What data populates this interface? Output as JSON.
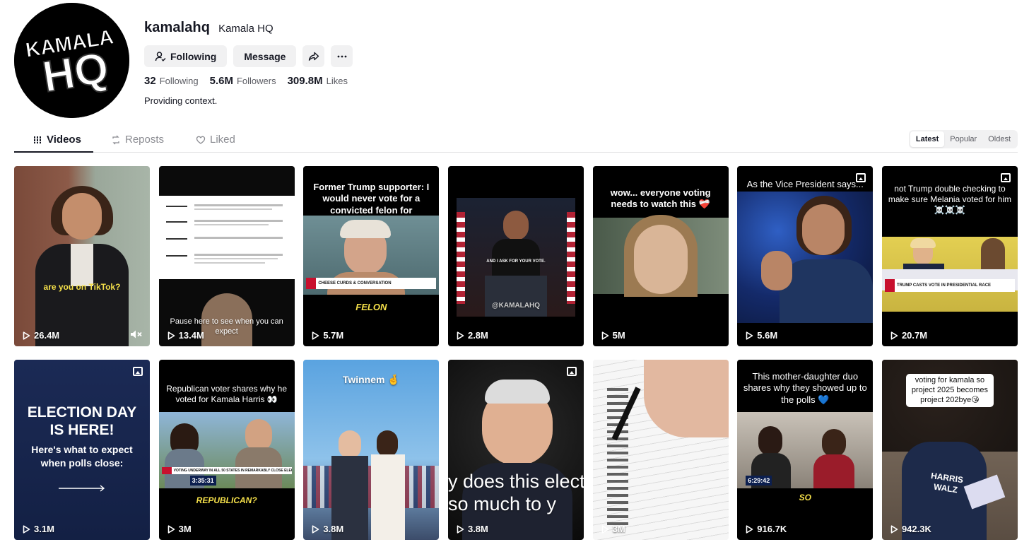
{
  "profile": {
    "avatar_text_top": "KAMALA",
    "avatar_text_bottom": "HQ",
    "username": "kamalahq",
    "nickname": "Kamala HQ",
    "following_label": "Following",
    "message_label": "Message",
    "bio": "Providing context.",
    "stats": [
      {
        "num": "32",
        "label": "Following"
      },
      {
        "num": "5.6M",
        "label": "Followers"
      },
      {
        "num": "309.8M",
        "label": "Likes"
      }
    ]
  },
  "tabs": [
    {
      "label": "Videos",
      "active": true
    },
    {
      "label": "Reposts",
      "active": false
    },
    {
      "label": "Liked",
      "active": false
    }
  ],
  "sort": [
    {
      "label": "Latest",
      "active": true
    },
    {
      "label": "Popular",
      "active": false
    },
    {
      "label": "Oldest",
      "active": false
    }
  ],
  "videos": [
    {
      "views": "26.4M",
      "top_text": "",
      "mid_text": "are you on TikTok?",
      "mute": true,
      "gallery": false
    },
    {
      "views": "13.4M",
      "top_text": "",
      "mid_text": "Pause here to see when you can expect",
      "mute": false,
      "gallery": false
    },
    {
      "views": "5.7M",
      "top_text": "Former Trump supporter: I would never vote for a convicted felon for president 💯",
      "mid_text": "FELON",
      "chyron": "CHEESE CURDS & CONVERSATION",
      "mute": false,
      "gallery": false
    },
    {
      "views": "2.8M",
      "top_text": "",
      "mid_text": "AND I ASK FOR YOUR VOTE.",
      "watermark": "@KAMALAHQ",
      "mute": false,
      "gallery": false
    },
    {
      "views": "5M",
      "top_text": "wow... everyone voting needs to watch this ❤️‍🩹",
      "mid_text": "",
      "mute": false,
      "gallery": false
    },
    {
      "views": "5.6M",
      "top_text": "As the Vice President says...",
      "mid_text": "",
      "mute": false,
      "gallery": true
    },
    {
      "views": "20.7M",
      "top_text": "not Trump double checking to make sure Melania voted for him ☠️☠️☠️",
      "mid_text": "",
      "chyron": "TRUMP CASTS VOTE IN PRESIDENTIAL RACE",
      "mute": false,
      "gallery": true
    },
    {
      "views": "3.1M",
      "top_text": "ELECTION DAY IS HERE!",
      "mid_text": "Here's what to expect when polls close:",
      "mute": false,
      "gallery": true
    },
    {
      "views": "3M",
      "top_text": "Republican voter shares why he voted for Kamala Harris 👀",
      "mid_text": "REPUBLICAN?",
      "chyron": "VOTING UNDERWAY IN ALL 50 STATES IN REMARKABLY CLOSE ELECTION",
      "clock": "3:35:31",
      "mute": false,
      "gallery": false
    },
    {
      "views": "3.8M",
      "top_text": "Twinnem 🤞",
      "mid_text": "",
      "mute": false,
      "gallery": false
    },
    {
      "views": "3.8M",
      "top_text": "",
      "mid_text": "y does this elect ter so much to y",
      "mute": false,
      "gallery": true
    },
    {
      "views": "3M",
      "top_text": "",
      "mid_text": "",
      "mute": false,
      "gallery": false
    },
    {
      "views": "916.7K",
      "top_text": "This mother-daughter duo shares why they showed up to the polls 💙",
      "mid_text": "SO",
      "clock": "6:29:42",
      "mute": false,
      "gallery": false
    },
    {
      "views": "942.3K",
      "top_text": "voting for kamala so project 2025 becomes project 202bye😘",
      "mid_text": "",
      "shirt": "HARRIS WALZ",
      "mute": false,
      "gallery": false
    }
  ],
  "colors": {
    "text": "#161823",
    "muted": "#8a8b91",
    "button_bg": "#f1f1f2",
    "cnn_red": "#c8102e",
    "caption_yellow": "#f5e04a"
  }
}
